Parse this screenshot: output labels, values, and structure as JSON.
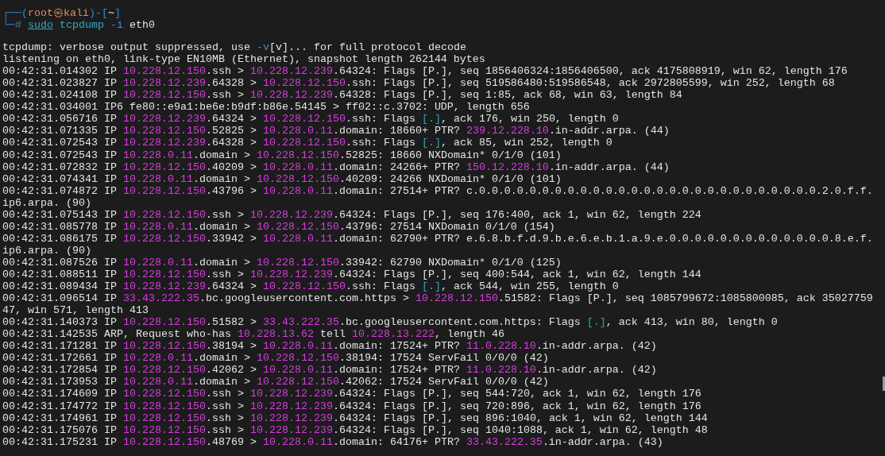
{
  "prompt": [
    [
      {
        "kind": "prompt",
        "text": "┌──("
      },
      {
        "kind": "user",
        "text": "root㉿kali"
      },
      {
        "kind": "prompt",
        "text": ")-["
      },
      {
        "kind": "plain",
        "text": "~"
      },
      {
        "kind": "prompt",
        "text": "]"
      }
    ],
    [
      {
        "kind": "prompt",
        "text": "└─# "
      },
      {
        "kind": "builtin",
        "text": "sudo"
      },
      {
        "kind": "command",
        "text": " tcpdump"
      },
      {
        "kind": "option",
        "text": " -i"
      },
      {
        "kind": "plain",
        "text": " eth0"
      }
    ]
  ],
  "output": [
    [
      {
        "kind": "plain",
        "text": "tcpdump: verbose output suppressed, use "
      },
      {
        "kind": "option",
        "text": "-v"
      },
      {
        "kind": "plain",
        "text": "[v]... for full protocol decode"
      }
    ],
    [
      {
        "kind": "plain",
        "text": "listening on eth0, link-type EN10MB (Ethernet), snapshot length 262144 bytes"
      }
    ],
    [
      {
        "kind": "plain",
        "text": "00:42:31.014302 IP "
      },
      {
        "kind": "ip",
        "text": "10.228.12.150"
      },
      {
        "kind": "plain",
        "text": ".ssh > "
      },
      {
        "kind": "ip",
        "text": "10.228.12.239"
      },
      {
        "kind": "plain",
        "text": ".64324: Flags [P.], seq 1856406324:1856406500, ack 4175808919, win 62, length 176"
      }
    ],
    [
      {
        "kind": "plain",
        "text": "00:42:31.023827 IP "
      },
      {
        "kind": "ip",
        "text": "10.228.12.239"
      },
      {
        "kind": "plain",
        "text": ".64328 > "
      },
      {
        "kind": "ip",
        "text": "10.228.12.150"
      },
      {
        "kind": "plain",
        "text": ".ssh: Flags [P.], seq 519586480:519586548, ack 2972805599, win 252, length 68"
      }
    ],
    [
      {
        "kind": "plain",
        "text": "00:42:31.024108 IP "
      },
      {
        "kind": "ip",
        "text": "10.228.12.150"
      },
      {
        "kind": "plain",
        "text": ".ssh > "
      },
      {
        "kind": "ip",
        "text": "10.228.12.239"
      },
      {
        "kind": "plain",
        "text": ".64328: Flags [P.], seq 1:85, ack 68, win 63, length 84"
      }
    ],
    [
      {
        "kind": "plain",
        "text": "00:42:31.034001 IP6 fe80::e9a1:be6e:b9df:b86e.54145 > ff02::c.3702: UDP, length 656"
      }
    ],
    [
      {
        "kind": "plain",
        "text": "00:42:31.056716 IP "
      },
      {
        "kind": "ip",
        "text": "10.228.12.239"
      },
      {
        "kind": "plain",
        "text": ".64324 > "
      },
      {
        "kind": "ip",
        "text": "10.228.12.150"
      },
      {
        "kind": "plain",
        "text": ".ssh: Flags "
      },
      {
        "kind": "flag",
        "text": "[.]"
      },
      {
        "kind": "plain",
        "text": ", ack 176, win 250, length 0"
      }
    ],
    [
      {
        "kind": "plain",
        "text": "00:42:31.071335 IP "
      },
      {
        "kind": "ip",
        "text": "10.228.12.150"
      },
      {
        "kind": "plain",
        "text": ".52825 > "
      },
      {
        "kind": "ip",
        "text": "10.228.0.11"
      },
      {
        "kind": "plain",
        "text": ".domain: 18660+ PTR? "
      },
      {
        "kind": "ip",
        "text": "239.12.228.10"
      },
      {
        "kind": "plain",
        "text": ".in-addr.arpa. (44)"
      }
    ],
    [
      {
        "kind": "plain",
        "text": "00:42:31.072543 IP "
      },
      {
        "kind": "ip",
        "text": "10.228.12.239"
      },
      {
        "kind": "plain",
        "text": ".64328 > "
      },
      {
        "kind": "ip",
        "text": "10.228.12.150"
      },
      {
        "kind": "plain",
        "text": ".ssh: Flags "
      },
      {
        "kind": "flag",
        "text": "[.]"
      },
      {
        "kind": "plain",
        "text": ", ack 85, win 252, length 0"
      }
    ],
    [
      {
        "kind": "plain",
        "text": "00:42:31.072543 IP "
      },
      {
        "kind": "ip",
        "text": "10.228.0.11"
      },
      {
        "kind": "plain",
        "text": ".domain > "
      },
      {
        "kind": "ip",
        "text": "10.228.12.150"
      },
      {
        "kind": "plain",
        "text": ".52825: 18660 NXDomain* 0/1/0 (101)"
      }
    ],
    [
      {
        "kind": "plain",
        "text": "00:42:31.072832 IP "
      },
      {
        "kind": "ip",
        "text": "10.228.12.150"
      },
      {
        "kind": "plain",
        "text": ".40209 > "
      },
      {
        "kind": "ip",
        "text": "10.228.0.11"
      },
      {
        "kind": "plain",
        "text": ".domain: 24266+ PTR? "
      },
      {
        "kind": "ip",
        "text": "150.12.228.10"
      },
      {
        "kind": "plain",
        "text": ".in-addr.arpa. (44)"
      }
    ],
    [
      {
        "kind": "plain",
        "text": "00:42:31.074341 IP "
      },
      {
        "kind": "ip",
        "text": "10.228.0.11"
      },
      {
        "kind": "plain",
        "text": ".domain > "
      },
      {
        "kind": "ip",
        "text": "10.228.12.150"
      },
      {
        "kind": "plain",
        "text": ".40209: 24266 NXDomain* 0/1/0 (101)"
      }
    ],
    [
      {
        "kind": "plain",
        "text": "00:42:31.074872 IP "
      },
      {
        "kind": "ip",
        "text": "10.228.12.150"
      },
      {
        "kind": "plain",
        "text": ".43796 > "
      },
      {
        "kind": "ip",
        "text": "10.228.0.11"
      },
      {
        "kind": "plain",
        "text": ".domain: 27514+ PTR? c.0.0.0.0.0.0.0.0.0.0.0.0.0.0.0.0.0.0.0.0.0.0.0.0.0.0.0.2.0.f.f."
      }
    ],
    [
      {
        "kind": "plain",
        "text": "ip6.arpa. (90)"
      }
    ],
    [
      {
        "kind": "plain",
        "text": "00:42:31.075143 IP "
      },
      {
        "kind": "ip",
        "text": "10.228.12.150"
      },
      {
        "kind": "plain",
        "text": ".ssh > "
      },
      {
        "kind": "ip",
        "text": "10.228.12.239"
      },
      {
        "kind": "plain",
        "text": ".64324: Flags [P.], seq 176:400, ack 1, win 62, length 224"
      }
    ],
    [
      {
        "kind": "plain",
        "text": "00:42:31.085778 IP "
      },
      {
        "kind": "ip",
        "text": "10.228.0.11"
      },
      {
        "kind": "plain",
        "text": ".domain > "
      },
      {
        "kind": "ip",
        "text": "10.228.12.150"
      },
      {
        "kind": "plain",
        "text": ".43796: 27514 NXDomain 0/1/0 (154)"
      }
    ],
    [
      {
        "kind": "plain",
        "text": "00:42:31.086175 IP "
      },
      {
        "kind": "ip",
        "text": "10.228.12.150"
      },
      {
        "kind": "plain",
        "text": ".33942 > "
      },
      {
        "kind": "ip",
        "text": "10.228.0.11"
      },
      {
        "kind": "plain",
        "text": ".domain: 62790+ PTR? e.6.8.b.f.d.9.b.e.6.e.b.1.a.9.e.0.0.0.0.0.0.0.0.0.0.0.0.0.8.e.f."
      }
    ],
    [
      {
        "kind": "plain",
        "text": "ip6.arpa. (90)"
      }
    ],
    [
      {
        "kind": "plain",
        "text": "00:42:31.087526 IP "
      },
      {
        "kind": "ip",
        "text": "10.228.0.11"
      },
      {
        "kind": "plain",
        "text": ".domain > "
      },
      {
        "kind": "ip",
        "text": "10.228.12.150"
      },
      {
        "kind": "plain",
        "text": ".33942: 62790 NXDomain* 0/1/0 (125)"
      }
    ],
    [
      {
        "kind": "plain",
        "text": "00:42:31.088511 IP "
      },
      {
        "kind": "ip",
        "text": "10.228.12.150"
      },
      {
        "kind": "plain",
        "text": ".ssh > "
      },
      {
        "kind": "ip",
        "text": "10.228.12.239"
      },
      {
        "kind": "plain",
        "text": ".64324: Flags [P.], seq 400:544, ack 1, win 62, length 144"
      }
    ],
    [
      {
        "kind": "plain",
        "text": "00:42:31.089434 IP "
      },
      {
        "kind": "ip",
        "text": "10.228.12.239"
      },
      {
        "kind": "plain",
        "text": ".64324 > "
      },
      {
        "kind": "ip",
        "text": "10.228.12.150"
      },
      {
        "kind": "plain",
        "text": ".ssh: Flags "
      },
      {
        "kind": "flag",
        "text": "[.]"
      },
      {
        "kind": "plain",
        "text": ", ack 544, win 255, length 0"
      }
    ],
    [
      {
        "kind": "plain",
        "text": "00:42:31.096514 IP "
      },
      {
        "kind": "ip",
        "text": "33.43.222.35"
      },
      {
        "kind": "plain",
        "text": ".bc.googleusercontent.com.https > "
      },
      {
        "kind": "ip",
        "text": "10.228.12.150"
      },
      {
        "kind": "plain",
        "text": ".51582: Flags [P.], seq 1085799672:1085800085, ack 35027759"
      }
    ],
    [
      {
        "kind": "plain",
        "text": "47, win 571, length 413"
      }
    ],
    [
      {
        "kind": "plain",
        "text": "00:42:31.140373 IP "
      },
      {
        "kind": "ip",
        "text": "10.228.12.150"
      },
      {
        "kind": "plain",
        "text": ".51582 > "
      },
      {
        "kind": "ip",
        "text": "33.43.222.35"
      },
      {
        "kind": "plain",
        "text": ".bc.googleusercontent.com.https: Flags "
      },
      {
        "kind": "flag",
        "text": "[.]"
      },
      {
        "kind": "plain",
        "text": ", ack 413, win 80, length 0"
      }
    ],
    [
      {
        "kind": "plain",
        "text": "00:42:31.142535 ARP, Request who-has "
      },
      {
        "kind": "ip",
        "text": "10.228.13.62"
      },
      {
        "kind": "plain",
        "text": " tell "
      },
      {
        "kind": "ip",
        "text": "10.228.13.222"
      },
      {
        "kind": "plain",
        "text": ", length 46"
      }
    ],
    [
      {
        "kind": "plain",
        "text": "00:42:31.171281 IP "
      },
      {
        "kind": "ip",
        "text": "10.228.12.150"
      },
      {
        "kind": "plain",
        "text": ".38194 > "
      },
      {
        "kind": "ip",
        "text": "10.228.0.11"
      },
      {
        "kind": "plain",
        "text": ".domain: 17524+ PTR? "
      },
      {
        "kind": "ip",
        "text": "11.0.228.10"
      },
      {
        "kind": "plain",
        "text": ".in-addr.arpa. (42)"
      }
    ],
    [
      {
        "kind": "plain",
        "text": "00:42:31.172661 IP "
      },
      {
        "kind": "ip",
        "text": "10.228.0.11"
      },
      {
        "kind": "plain",
        "text": ".domain > "
      },
      {
        "kind": "ip",
        "text": "10.228.12.150"
      },
      {
        "kind": "plain",
        "text": ".38194: 17524 ServFail 0/0/0 (42)"
      }
    ],
    [
      {
        "kind": "plain",
        "text": "00:42:31.172854 IP "
      },
      {
        "kind": "ip",
        "text": "10.228.12.150"
      },
      {
        "kind": "plain",
        "text": ".42062 > "
      },
      {
        "kind": "ip",
        "text": "10.228.0.11"
      },
      {
        "kind": "plain",
        "text": ".domain: 17524+ PTR? "
      },
      {
        "kind": "ip",
        "text": "11.0.228.10"
      },
      {
        "kind": "plain",
        "text": ".in-addr.arpa. (42)"
      }
    ],
    [
      {
        "kind": "plain",
        "text": "00:42:31.173953 IP "
      },
      {
        "kind": "ip",
        "text": "10.228.0.11"
      },
      {
        "kind": "plain",
        "text": ".domain > "
      },
      {
        "kind": "ip",
        "text": "10.228.12.150"
      },
      {
        "kind": "plain",
        "text": ".42062: 17524 ServFail 0/0/0 (42)"
      }
    ],
    [
      {
        "kind": "plain",
        "text": "00:42:31.174609 IP "
      },
      {
        "kind": "ip",
        "text": "10.228.12.150"
      },
      {
        "kind": "plain",
        "text": ".ssh > "
      },
      {
        "kind": "ip",
        "text": "10.228.12.239"
      },
      {
        "kind": "plain",
        "text": ".64324: Flags [P.], seq 544:720, ack 1, win 62, length 176"
      }
    ],
    [
      {
        "kind": "plain",
        "text": "00:42:31.174772 IP "
      },
      {
        "kind": "ip",
        "text": "10.228.12.150"
      },
      {
        "kind": "plain",
        "text": ".ssh > "
      },
      {
        "kind": "ip",
        "text": "10.228.12.239"
      },
      {
        "kind": "plain",
        "text": ".64324: Flags [P.], seq 720:896, ack 1, win 62, length 176"
      }
    ],
    [
      {
        "kind": "plain",
        "text": "00:42:31.174961 IP "
      },
      {
        "kind": "ip",
        "text": "10.228.12.150"
      },
      {
        "kind": "plain",
        "text": ".ssh > "
      },
      {
        "kind": "ip",
        "text": "10.228.12.239"
      },
      {
        "kind": "plain",
        "text": ".64324: Flags [P.], seq 896:1040, ack 1, win 62, length 144"
      }
    ],
    [
      {
        "kind": "plain",
        "text": "00:42:31.175076 IP "
      },
      {
        "kind": "ip",
        "text": "10.228.12.150"
      },
      {
        "kind": "plain",
        "text": ".ssh > "
      },
      {
        "kind": "ip",
        "text": "10.228.12.239"
      },
      {
        "kind": "plain",
        "text": ".64324: Flags [P.], seq 1040:1088, ack 1, win 62, length 48"
      }
    ],
    [
      {
        "kind": "plain",
        "text": "00:42:31.175231 IP "
      },
      {
        "kind": "ip",
        "text": "10.228.12.150"
      },
      {
        "kind": "plain",
        "text": ".48769 > "
      },
      {
        "kind": "ip",
        "text": "10.228.0.11"
      },
      {
        "kind": "plain",
        "text": ".domain: 64176+ PTR? "
      },
      {
        "kind": "ip",
        "text": "33.43.222.35"
      },
      {
        "kind": "plain",
        "text": ".in-addr.arpa. (43)"
      }
    ]
  ]
}
